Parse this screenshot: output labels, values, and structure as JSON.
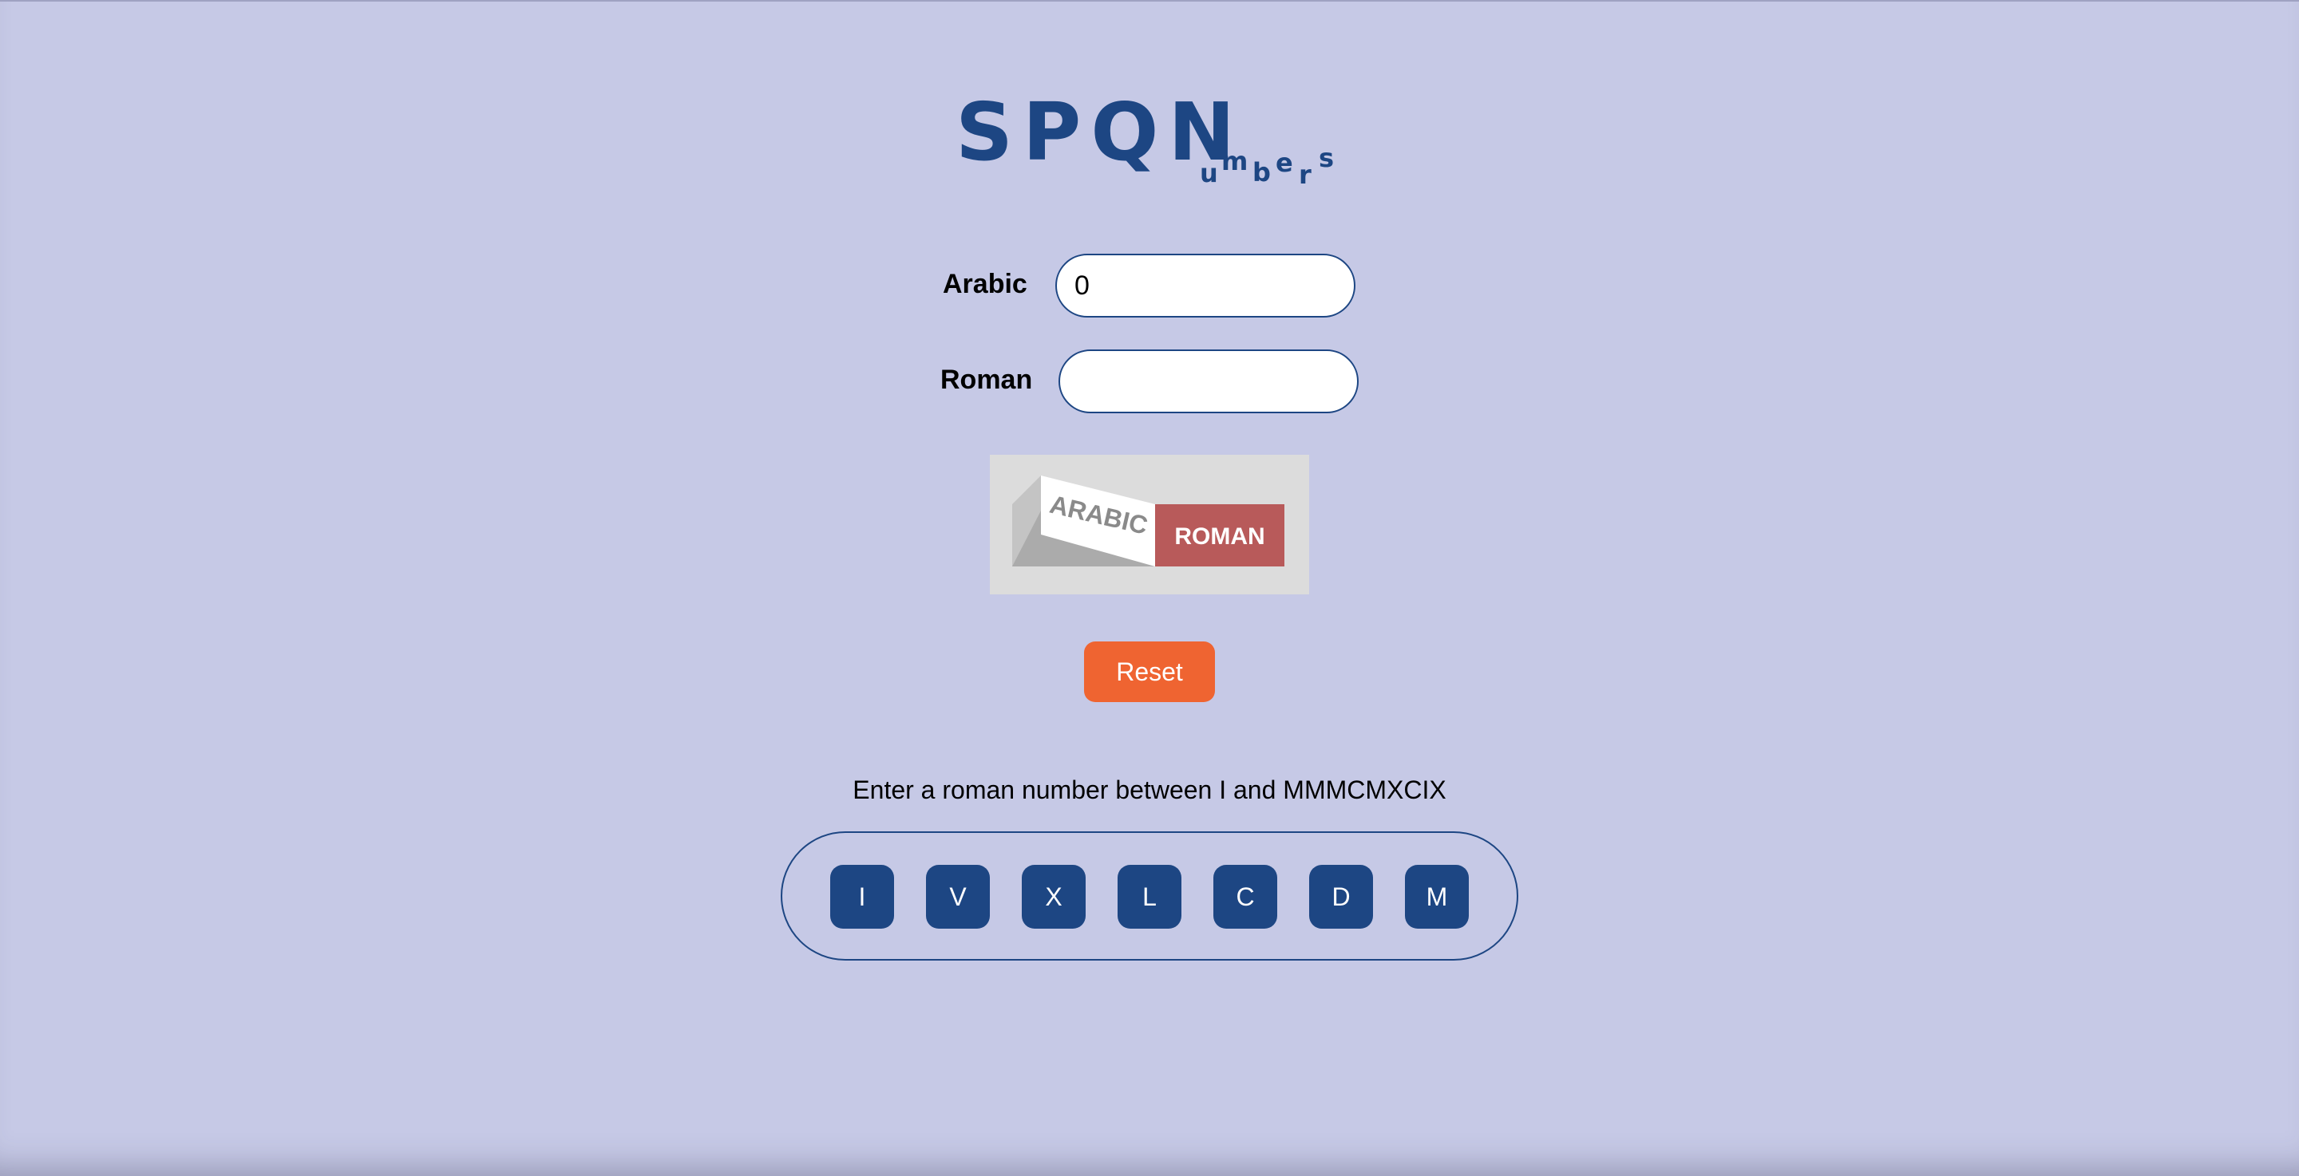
{
  "logo": {
    "main": "SPQN",
    "sub_letters": [
      "u",
      "m",
      "b",
      "e",
      "r",
      "s"
    ]
  },
  "form": {
    "arabic_label": "Arabic",
    "arabic_value": "0",
    "roman_label": "Roman",
    "roman_value": ""
  },
  "toggle": {
    "left_label": "ARABIC",
    "right_label": "ROMAN",
    "active": "ROMAN"
  },
  "reset_label": "Reset",
  "instruction": "Enter a roman number between I and MMMCMXCIX",
  "keys": [
    "I",
    "V",
    "X",
    "L",
    "C",
    "D",
    "M"
  ],
  "colors": {
    "background": "#c6c9e6",
    "primary": "#1d4683",
    "accent": "#ef6431",
    "toggle_active": "#b85a5a"
  }
}
